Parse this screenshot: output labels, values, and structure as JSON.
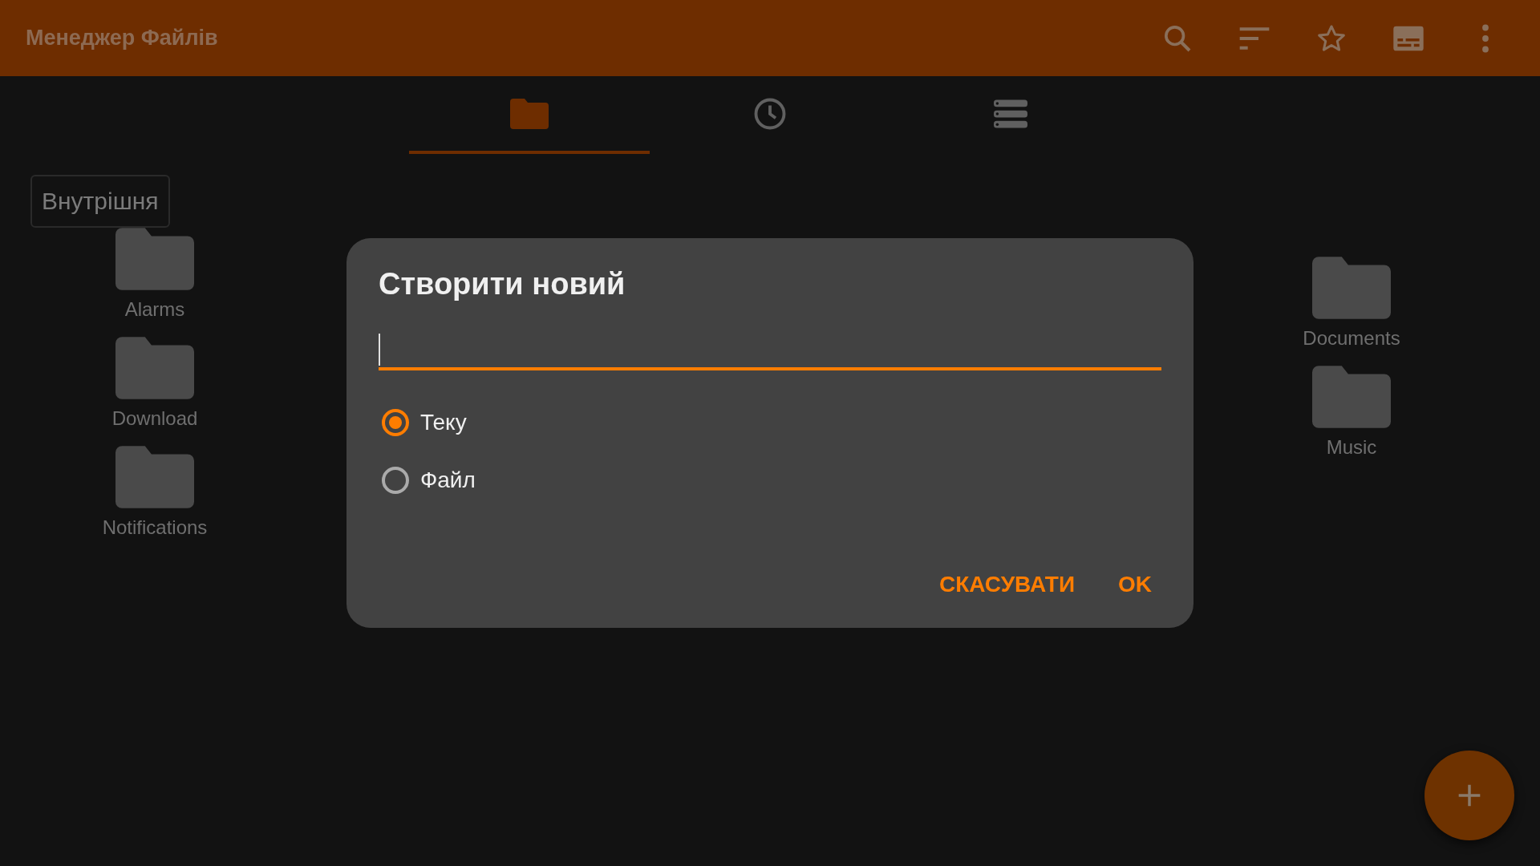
{
  "app_bar": {
    "title": "Менеджер Файлів",
    "actions": [
      {
        "kind": "search"
      },
      {
        "kind": "sort"
      },
      {
        "kind": "star"
      },
      {
        "kind": "caption"
      },
      {
        "kind": "more"
      }
    ]
  },
  "tabs": [
    {
      "kind": "folder",
      "selected": true
    },
    {
      "kind": "clock",
      "selected": false
    },
    {
      "kind": "storage",
      "selected": false
    }
  ],
  "storage_chip": {
    "label": "Внутрішня"
  },
  "folder_columns": [
    [
      {
        "name": "Alarms"
      },
      {
        "name": "Download"
      },
      {
        "name": "Notifications"
      }
    ],
    [
      {
        "name": "Documents"
      },
      {
        "name": "Music"
      }
    ]
  ],
  "dialog": {
    "title": "Створити новий",
    "field": {
      "focused": true
    },
    "options": [
      {
        "label": "Теку",
        "selected": true
      },
      {
        "label": "Файл",
        "selected": false
      }
    ],
    "buttons": [
      "СКАСУВАТИ",
      "OK"
    ]
  },
  "fab": {
    "kind": "add"
  }
}
